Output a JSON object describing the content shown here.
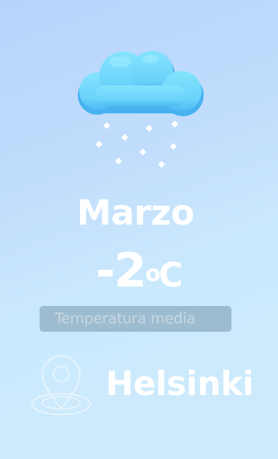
{
  "weather": {
    "icon": "cloud-snow-icon",
    "month": "Marzo",
    "temperature_value": "-2",
    "temperature_unit_degree": "o",
    "temperature_unit": "C",
    "caption": "Temperatura media"
  },
  "location": {
    "icon": "map-pin-icon",
    "city": "Helsinki"
  },
  "colors": {
    "background_top": "#b6d3fb",
    "background_bottom": "#cdebfc",
    "cloud": "#6dd4fb",
    "cloud_shadow": "#43b4f1",
    "snow": "#ffffff",
    "badge": "#9ebcd0",
    "text": "#ffffff"
  }
}
